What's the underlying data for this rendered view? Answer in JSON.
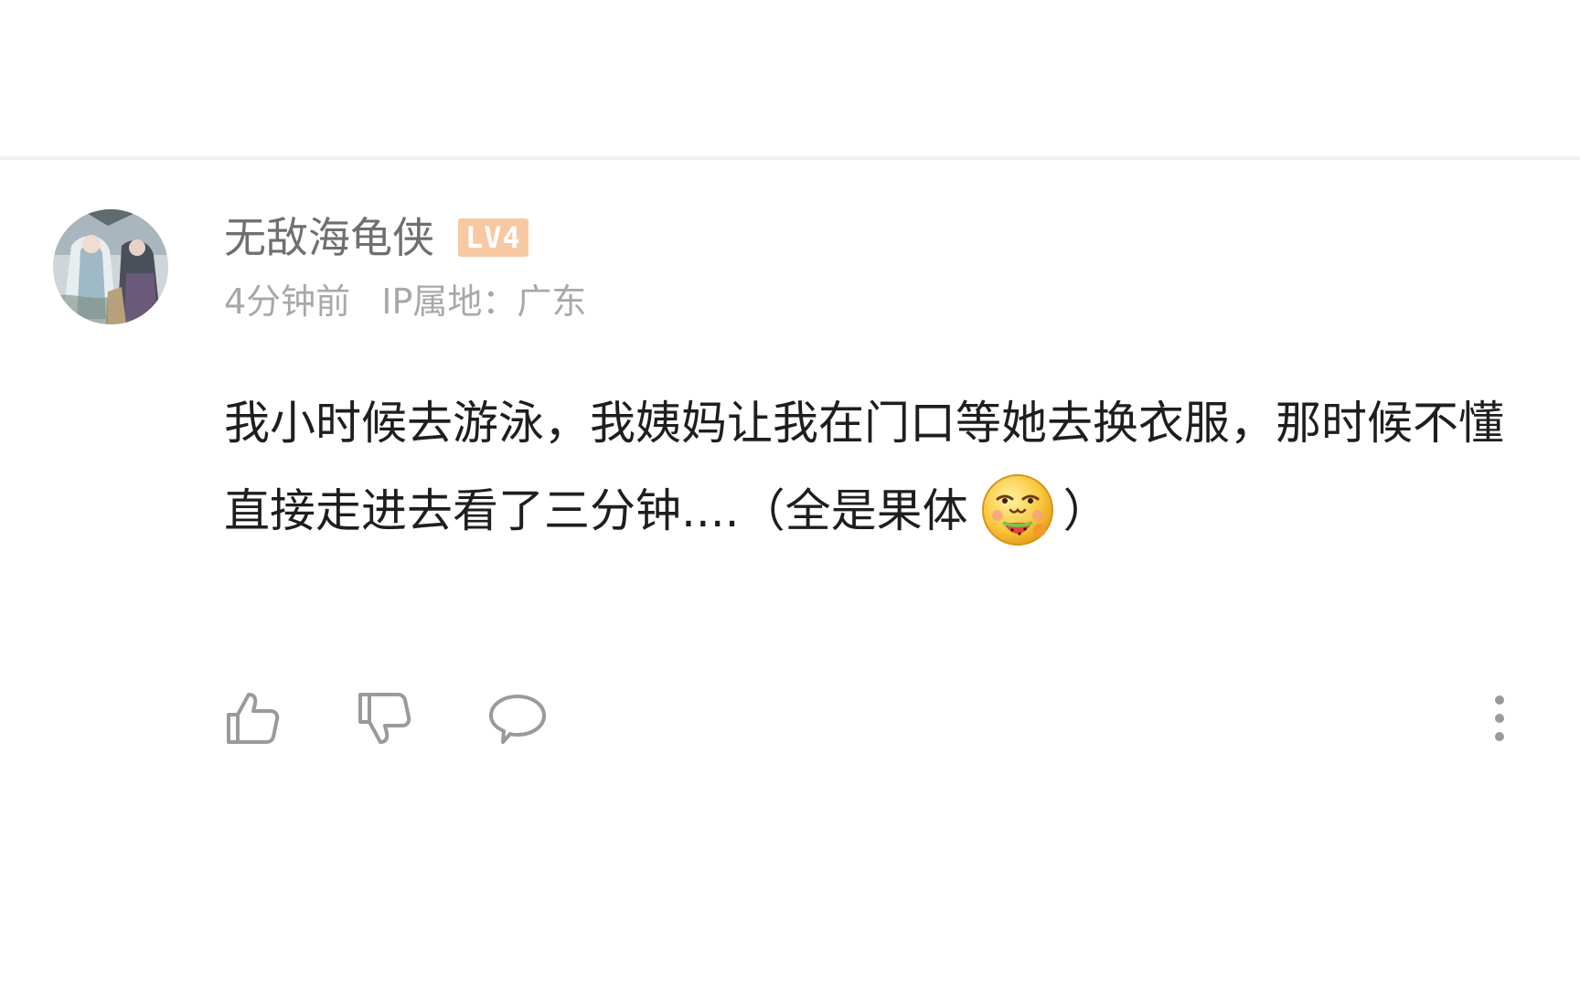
{
  "comment": {
    "username": "无敌海龟侠",
    "level_badge": "LV4",
    "time_ago": "4分钟前",
    "ip_location": "IP属地：广东",
    "text_main": "我小时候去游泳，我姨妈让我在门口等她去换衣服，那时候不懂直接走进去看了三分钟....（全是果体",
    "text_end": "）",
    "emoji_name": "watermelon-grin-emoji",
    "colors": {
      "username": "#6f6f6f",
      "meta": "#a8a8a8",
      "body": "#1e1e1e",
      "badge": "#f7c9a3"
    }
  },
  "actions": {
    "like_icon": "thumbs-up-icon",
    "dislike_icon": "thumbs-down-icon",
    "reply_icon": "speech-bubble-icon",
    "more_icon": "vertical-dots-icon"
  }
}
